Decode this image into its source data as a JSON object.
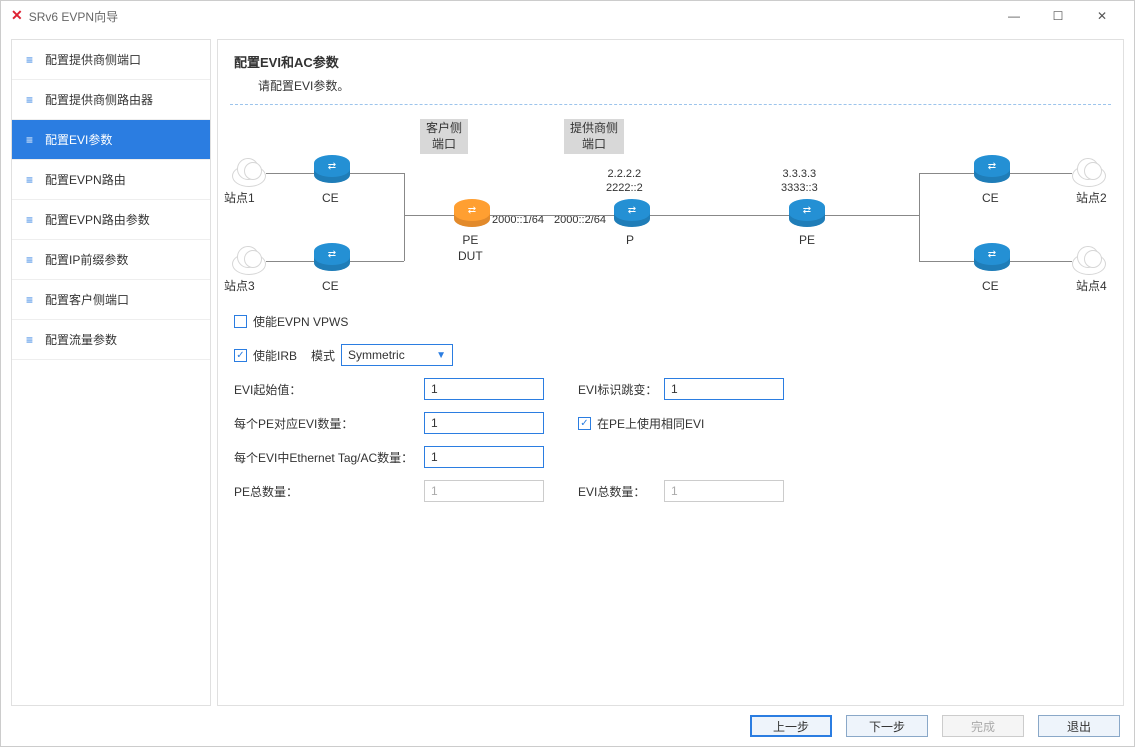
{
  "window": {
    "title": "SRv6 EVPN向导"
  },
  "sidebar": {
    "items": [
      {
        "label": "配置提供商侧端口"
      },
      {
        "label": "配置提供商侧路由器"
      },
      {
        "label": "配置EVI参数"
      },
      {
        "label": "配置EVPN路由"
      },
      {
        "label": "配置EVPN路由参数"
      },
      {
        "label": "配置IP前缀参数"
      },
      {
        "label": "配置客户侧端口"
      },
      {
        "label": "配置流量参数"
      }
    ],
    "active_index": 2
  },
  "header": {
    "title": "配置EVI和AC参数",
    "subtitle": "请配置EVI参数。"
  },
  "topology": {
    "customer_port_label": "客户侧\n端口",
    "provider_port_label": "提供商侧\n端口",
    "site1": "站点1",
    "site2": "站点2",
    "site3": "站点3",
    "site4": "站点4",
    "ce": "CE",
    "pe_dut": "PE\nDUT",
    "p": "P",
    "pe": "PE",
    "ip_left": "2000::1/64",
    "ip_right": "2000::2/64",
    "p_addr": "2.2.2.2\n2222::2",
    "pe_addr": "3.3.3.3\n3333::3"
  },
  "form": {
    "enable_vpws_label": "使能EVPN VPWS",
    "enable_vpws_checked": false,
    "enable_irb_label": "使能IRB",
    "enable_irb_checked": true,
    "mode_label": "模式",
    "mode_value": "Symmetric",
    "evi_start_label": "EVI起始值：",
    "evi_start_value": "1",
    "evi_step_label": "EVI标识跳变：",
    "evi_step_value": "1",
    "evi_per_pe_label": "每个PE对应EVI数量：",
    "evi_per_pe_value": "1",
    "same_evi_label": "在PE上使用相同EVI",
    "same_evi_checked": true,
    "tag_per_evi_label": "每个EVI中Ethernet Tag/AC数量：",
    "tag_per_evi_value": "1",
    "pe_total_label": "PE总数量：",
    "pe_total_value": "1",
    "evi_total_label": "EVI总数量：",
    "evi_total_value": "1"
  },
  "footer": {
    "prev": "上一步",
    "next": "下一步",
    "finish": "完成",
    "exit": "退出"
  }
}
